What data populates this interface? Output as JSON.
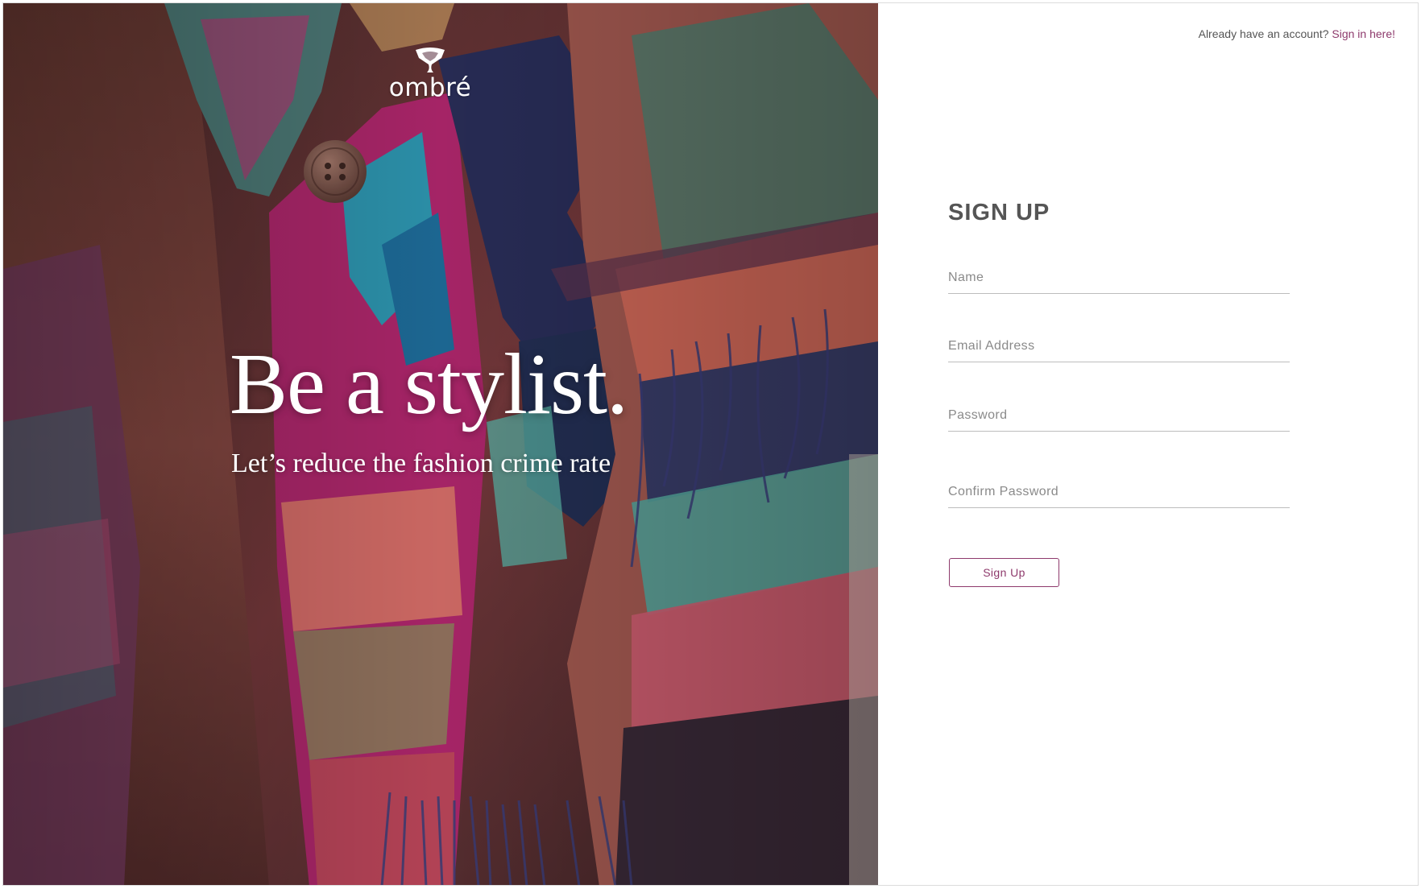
{
  "brand": {
    "logo_text": "ombré"
  },
  "hero": {
    "headline": "Be a stylist.",
    "subheadline": "Let’s reduce the fashion crime rate"
  },
  "header": {
    "account_prompt": "Already have an account?",
    "signin_link": "Sign in here!"
  },
  "form": {
    "title": "SIGN UP",
    "fields": [
      {
        "name": "name",
        "placeholder": "Name",
        "value": ""
      },
      {
        "name": "email",
        "placeholder": "Email Address",
        "value": ""
      },
      {
        "name": "password",
        "placeholder": "Password",
        "value": ""
      },
      {
        "name": "confirm_password",
        "placeholder": "Confirm Password",
        "value": ""
      }
    ],
    "submit_label": "Sign Up"
  },
  "colors": {
    "accent": "#8e3a6c",
    "text_gray": "#555555",
    "field_line": "#bdbdbd"
  },
  "icons": {
    "logo": "hanger-bow-icon"
  }
}
